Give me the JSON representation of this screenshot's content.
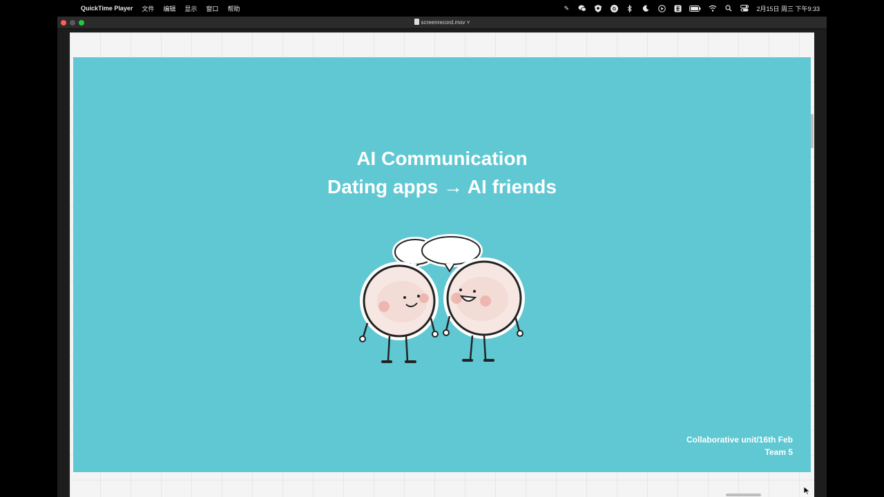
{
  "menubar": {
    "app_name": "QuickTime Player",
    "menus": [
      "文件",
      "编辑",
      "显示",
      "窗口",
      "帮助"
    ],
    "status_icons": [
      "pen-icon",
      "wechat-icon",
      "shield-icon",
      "grammarly-icon",
      "bluetooth-icon",
      "moon-icon",
      "play-icon",
      "keyboard-icon",
      "battery-icon",
      "wifi-icon",
      "search-icon",
      "control-center-icon"
    ],
    "clock": "2月15日 周三 下午9:33"
  },
  "window": {
    "title": "screenrecord.mov"
  },
  "slide": {
    "title_line1": "AI Communication",
    "title_line2": "Dating apps → AI friends",
    "footer_line1": "Collaborative unit/16th Feb",
    "footer_line2": "Team 5",
    "background": "#5fc8d2"
  }
}
